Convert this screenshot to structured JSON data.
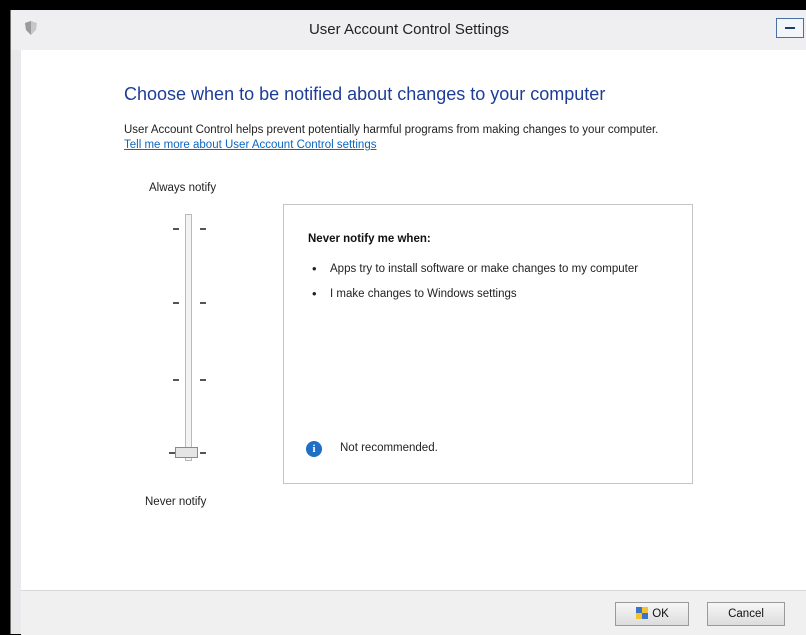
{
  "window": {
    "title": "User Account Control Settings",
    "icon": "uac-shield-icon"
  },
  "main": {
    "heading": "Choose when to be notified about changes to your computer",
    "description": "User Account Control helps prevent potentially harmful programs from making changes to your computer.",
    "link": "Tell me more about User Account Control settings"
  },
  "slider": {
    "top_label": "Always notify",
    "bottom_label": "Never notify",
    "levels": 4,
    "selected_level": 1
  },
  "info": {
    "title": "Never notify me when:",
    "bullets": [
      "Apps try to install software or make changes to my computer",
      "I make changes to Windows settings"
    ],
    "note": "Not recommended.",
    "note_icon": "info-icon"
  },
  "buttons": {
    "ok": "OK",
    "cancel": "Cancel"
  },
  "colors": {
    "heading": "#1e3d96",
    "link": "#0b66c2",
    "info_icon": "#1f6fc5"
  }
}
